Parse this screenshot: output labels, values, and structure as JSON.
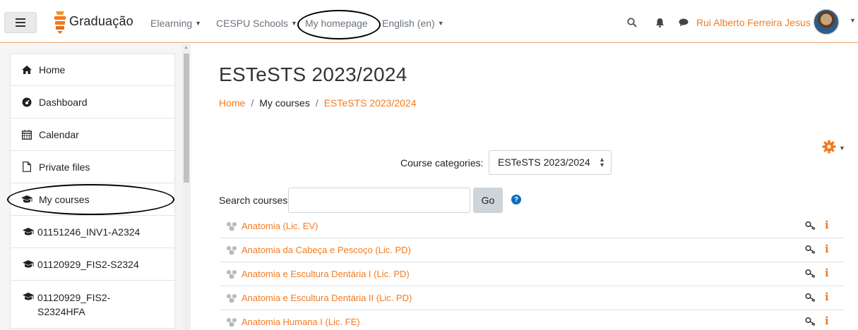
{
  "navbar": {
    "brand": "Graduação",
    "menu": [
      {
        "label": "Elearning",
        "has_caret": true
      },
      {
        "label": "CESPU Schools",
        "has_caret": true
      },
      {
        "label": "My homepage",
        "has_caret": false
      },
      {
        "label": "English (en)",
        "has_caret": true
      }
    ],
    "user_name": "Rui Alberto Ferreira Jesus",
    "icons": [
      "menu-icon",
      "search-icon",
      "bell-icon",
      "chat-icon"
    ]
  },
  "sidebar": {
    "items": [
      {
        "label": "Home",
        "icon": "home-icon"
      },
      {
        "label": "Dashboard",
        "icon": "dashboard-icon"
      },
      {
        "label": "Calendar",
        "icon": "calendar-icon"
      },
      {
        "label": "Private files",
        "icon": "file-icon"
      },
      {
        "label": "My courses",
        "icon": "graduation-cap-icon"
      },
      {
        "label": "01151246_INV1-A2324",
        "icon": "graduation-cap-icon"
      },
      {
        "label": "01120929_FIS2-S2324",
        "icon": "graduation-cap-icon"
      },
      {
        "label": "01120929_FIS2-\nS2324HFA",
        "icon": "graduation-cap-icon"
      }
    ]
  },
  "main": {
    "title": "ESTeSTS 2023/2024",
    "breadcrumb": [
      {
        "label": "Home",
        "link": true
      },
      {
        "label": "My courses",
        "link": false
      },
      {
        "label": "ESTeSTS 2023/2024",
        "link": true
      }
    ],
    "course_categories_label": "Course categories:",
    "course_categories_value": "ESTeSTS 2023/2024",
    "search_label": "Search courses",
    "search_value": "",
    "go_label": "Go",
    "courses": [
      "Anatomia (Lic. EV)",
      "Anatomia da Cabeça e Pescoço (Lic. PD)",
      "Anatomia e Escultura Dentária I (Lic. PD)",
      "Anatomia e Escultura Dentária II (Lic. PD)",
      "Anatomia Humana I (Lic. FE)"
    ]
  },
  "colors": {
    "accent": "#f37b21",
    "help": "#0f6cbf"
  }
}
